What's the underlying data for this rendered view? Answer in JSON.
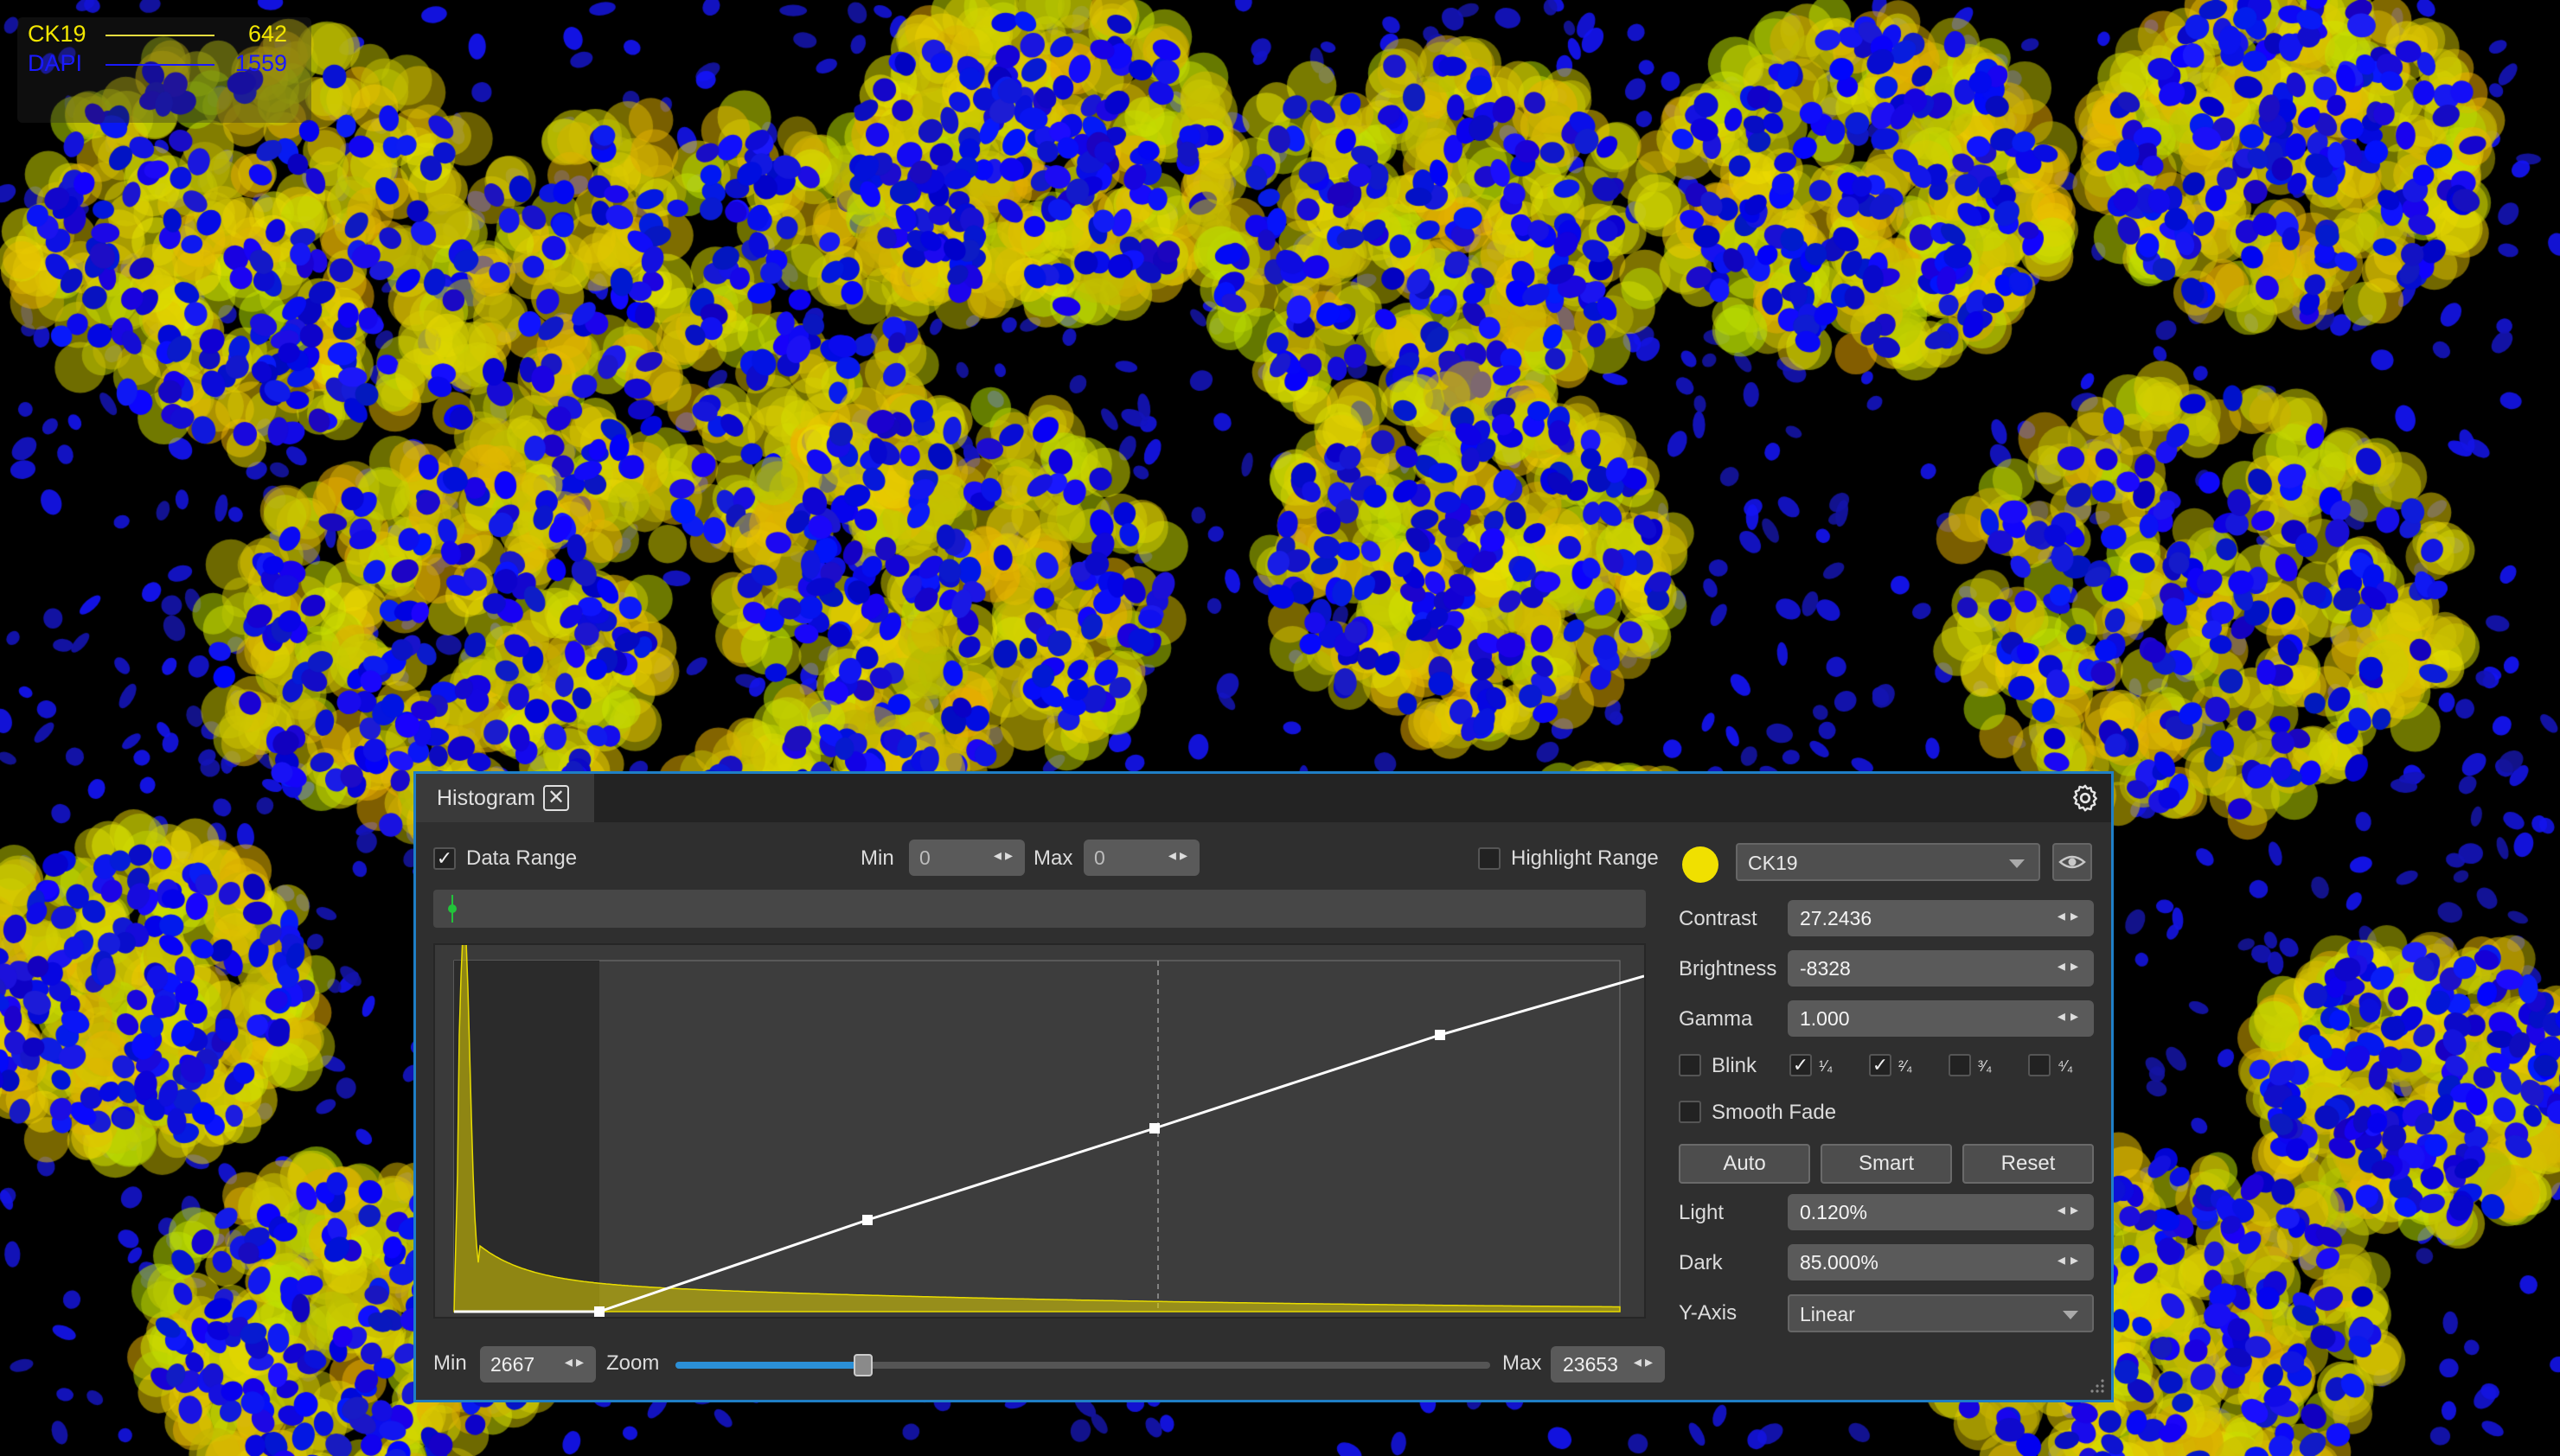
{
  "overlay": {
    "channels": [
      {
        "name": "CK19",
        "value": "642",
        "color": "#f2e600"
      },
      {
        "name": "DAPI",
        "value": "1559",
        "color": "#1a1aff"
      }
    ]
  },
  "histogram": {
    "tab_label": "Histogram",
    "tab_close_icon": "close-icon",
    "settings_icon": "gear-icon",
    "data_range_label": "Data Range",
    "data_range_checked": true,
    "min_label": "Min",
    "min_value": "0",
    "max_label": "Max",
    "max_value": "0",
    "highlight_range_label": "Highlight Range",
    "highlight_range_checked": false,
    "zoom_min_label": "Min",
    "zoom_min_value": "2667",
    "zoom_label": "Zoom",
    "zoom_level": 0.23,
    "zoom_max_label": "Max",
    "zoom_max_value": "23653",
    "curve_color": "#ffffff",
    "histogram_color": "#e8dc00"
  },
  "channel_settings": {
    "swatch_color": "#f0e000",
    "channel_select": "CK19",
    "eye_icon": "eye-icon",
    "contrast_label": "Contrast",
    "contrast_value": "27.2436",
    "brightness_label": "Brightness",
    "brightness_value": "-8328",
    "gamma_label": "Gamma",
    "gamma_value": "1.000",
    "blink_label": "Blink",
    "blink_checked": false,
    "blink_options": [
      {
        "label": "¹⁄₄",
        "checked": true
      },
      {
        "label": "²⁄₄",
        "checked": true
      },
      {
        "label": "³⁄₄",
        "checked": false
      },
      {
        "label": "⁴⁄₄",
        "checked": false
      }
    ],
    "smooth_fade_label": "Smooth Fade",
    "smooth_fade_checked": false,
    "auto_label": "Auto",
    "smart_label": "Smart",
    "reset_label": "Reset",
    "light_label": "Light",
    "light_value": "0.120%",
    "dark_label": "Dark",
    "dark_value": "85.000%",
    "yaxis_label": "Y-Axis",
    "yaxis_value": "Linear"
  }
}
